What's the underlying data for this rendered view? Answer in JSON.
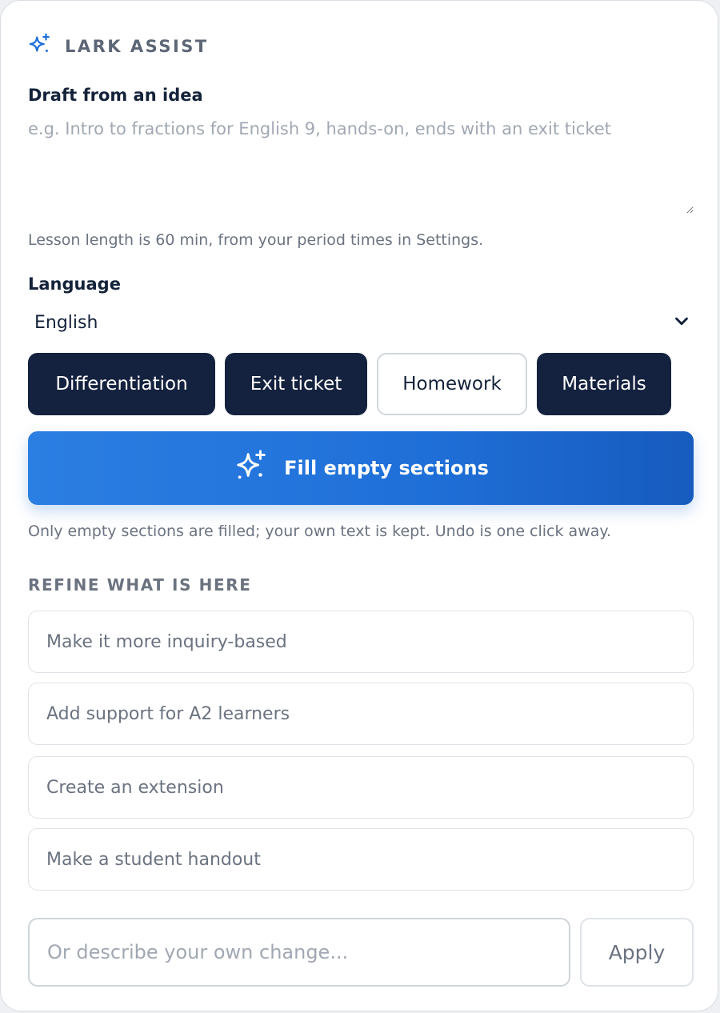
{
  "header": {
    "brand": "LARK ASSIST",
    "icon": "sparkle-icon",
    "accent": "#1f6fd8"
  },
  "draft": {
    "label": "Draft from an idea",
    "placeholder": "e.g. Intro to fractions for English 9, hands-on, ends with an exit ticket",
    "value": "",
    "length_hint": "Lesson length is 60 min, from your period times in Settings."
  },
  "language": {
    "label": "Language",
    "selected": "English",
    "icon": "chevron-down-icon"
  },
  "chips": [
    {
      "label": "Differentiation",
      "selected": true
    },
    {
      "label": "Exit ticket",
      "selected": true
    },
    {
      "label": "Homework",
      "selected": false
    },
    {
      "label": "Materials",
      "selected": true
    }
  ],
  "fill": {
    "label": "Fill empty sections",
    "icon": "sparkle-icon",
    "note": "Only empty sections are filled; your own text is kept. Undo is one click away."
  },
  "refine": {
    "title": "REFINE WHAT IS HERE",
    "options": [
      "Make it more inquiry-based",
      "Add support for A2 learners",
      "Create an extension",
      "Make a student handout"
    ],
    "custom_placeholder": "Or describe your own change...",
    "apply_label": "Apply"
  }
}
